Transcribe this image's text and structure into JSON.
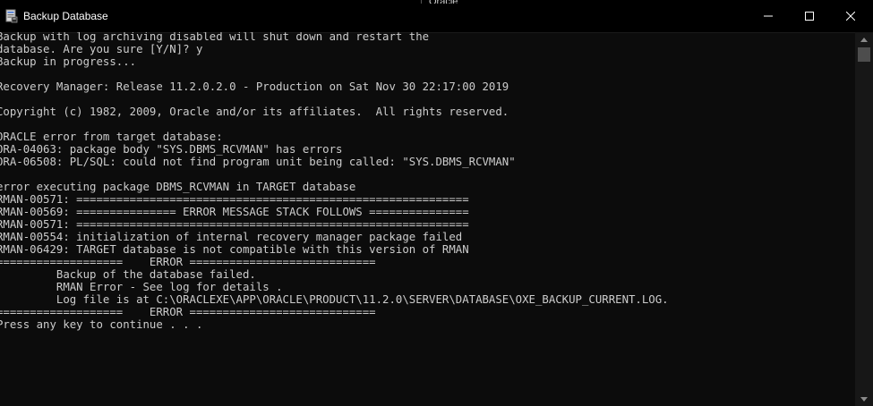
{
  "window": {
    "title": "Backup Database",
    "behind_window_title": "Oracle"
  },
  "console": {
    "lines": [
      "Backup with log archiving disabled will shut down and restart the",
      "database. Are you sure [Y/N]? y",
      "Backup in progress...",
      "",
      "Recovery Manager: Release 11.2.0.2.0 - Production on Sat Nov 30 22:17:00 2019",
      "",
      "Copyright (c) 1982, 2009, Oracle and/or its affiliates.  All rights reserved.",
      "",
      "ORACLE error from target database:",
      "ORA-04063: package body \"SYS.DBMS_RCVMAN\" has errors",
      "ORA-06508: PL/SQL: could not find program unit being called: \"SYS.DBMS_RCVMAN\"",
      "",
      "error executing package DBMS_RCVMAN in TARGET database",
      "RMAN-00571: ===========================================================",
      "RMAN-00569: =============== ERROR MESSAGE STACK FOLLOWS ===============",
      "RMAN-00571: ===========================================================",
      "RMAN-00554: initialization of internal recovery manager package failed",
      "RMAN-06429: TARGET database is not compatible with this version of RMAN",
      "===================    ERROR ============================",
      "         Backup of the database failed.",
      "         RMAN Error - See log for details .",
      "         Log file is at C:\\ORACLEXE\\APP\\ORACLE\\PRODUCT\\11.2.0\\SERVER\\DATABASE\\OXE_BACKUP_CURRENT.LOG.",
      "===================    ERROR ============================",
      "Press any key to continue . . ."
    ]
  },
  "icons": {
    "app": "console-app-icon",
    "minimize": "minimize-icon",
    "maximize": "maximize-icon",
    "close": "close-icon",
    "scroll_up": "scroll-up-arrow-icon",
    "scroll_down": "scroll-down-arrow-icon"
  },
  "colors": {
    "background": "#0c0c0c",
    "text": "#cccccc",
    "titlebar": "#000000",
    "title_text": "#ffffff"
  }
}
